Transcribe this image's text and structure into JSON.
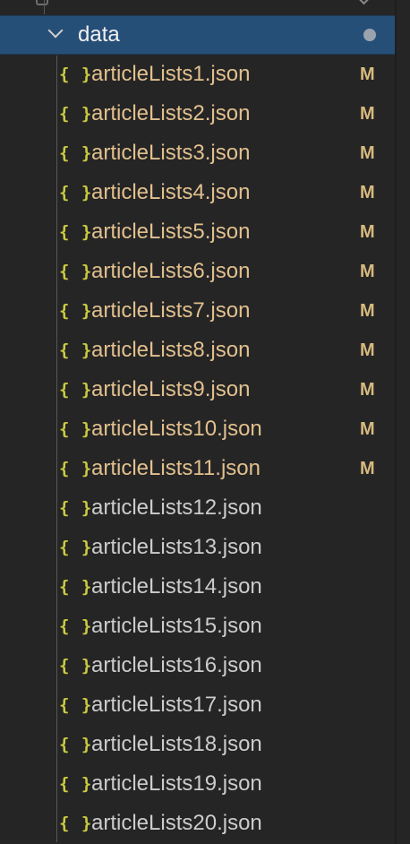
{
  "explorer": {
    "folder": {
      "name": "data",
      "expanded": true,
      "has_changes": true
    },
    "file_icon": "{ }",
    "files": [
      {
        "name": "articleLists1.json",
        "status": "M"
      },
      {
        "name": "articleLists2.json",
        "status": "M"
      },
      {
        "name": "articleLists3.json",
        "status": "M"
      },
      {
        "name": "articleLists4.json",
        "status": "M"
      },
      {
        "name": "articleLists5.json",
        "status": "M"
      },
      {
        "name": "articleLists6.json",
        "status": "M"
      },
      {
        "name": "articleLists7.json",
        "status": "M"
      },
      {
        "name": "articleLists8.json",
        "status": "M"
      },
      {
        "name": "articleLists9.json",
        "status": "M"
      },
      {
        "name": "articleLists10.json",
        "status": "M"
      },
      {
        "name": "articleLists11.json",
        "status": "M"
      },
      {
        "name": "articleLists12.json",
        "status": ""
      },
      {
        "name": "articleLists13.json",
        "status": ""
      },
      {
        "name": "articleLists14.json",
        "status": ""
      },
      {
        "name": "articleLists15.json",
        "status": ""
      },
      {
        "name": "articleLists16.json",
        "status": ""
      },
      {
        "name": "articleLists17.json",
        "status": ""
      },
      {
        "name": "articleLists18.json",
        "status": ""
      },
      {
        "name": "articleLists19.json",
        "status": ""
      },
      {
        "name": "articleLists20.json",
        "status": ""
      }
    ],
    "colors": {
      "background": "#252526",
      "selection": "#264f78",
      "modified_text": "#e2c08d",
      "normal_text": "#cccccc",
      "json_icon": "#cbcb41",
      "status_letter": "#d7ba7d"
    }
  }
}
